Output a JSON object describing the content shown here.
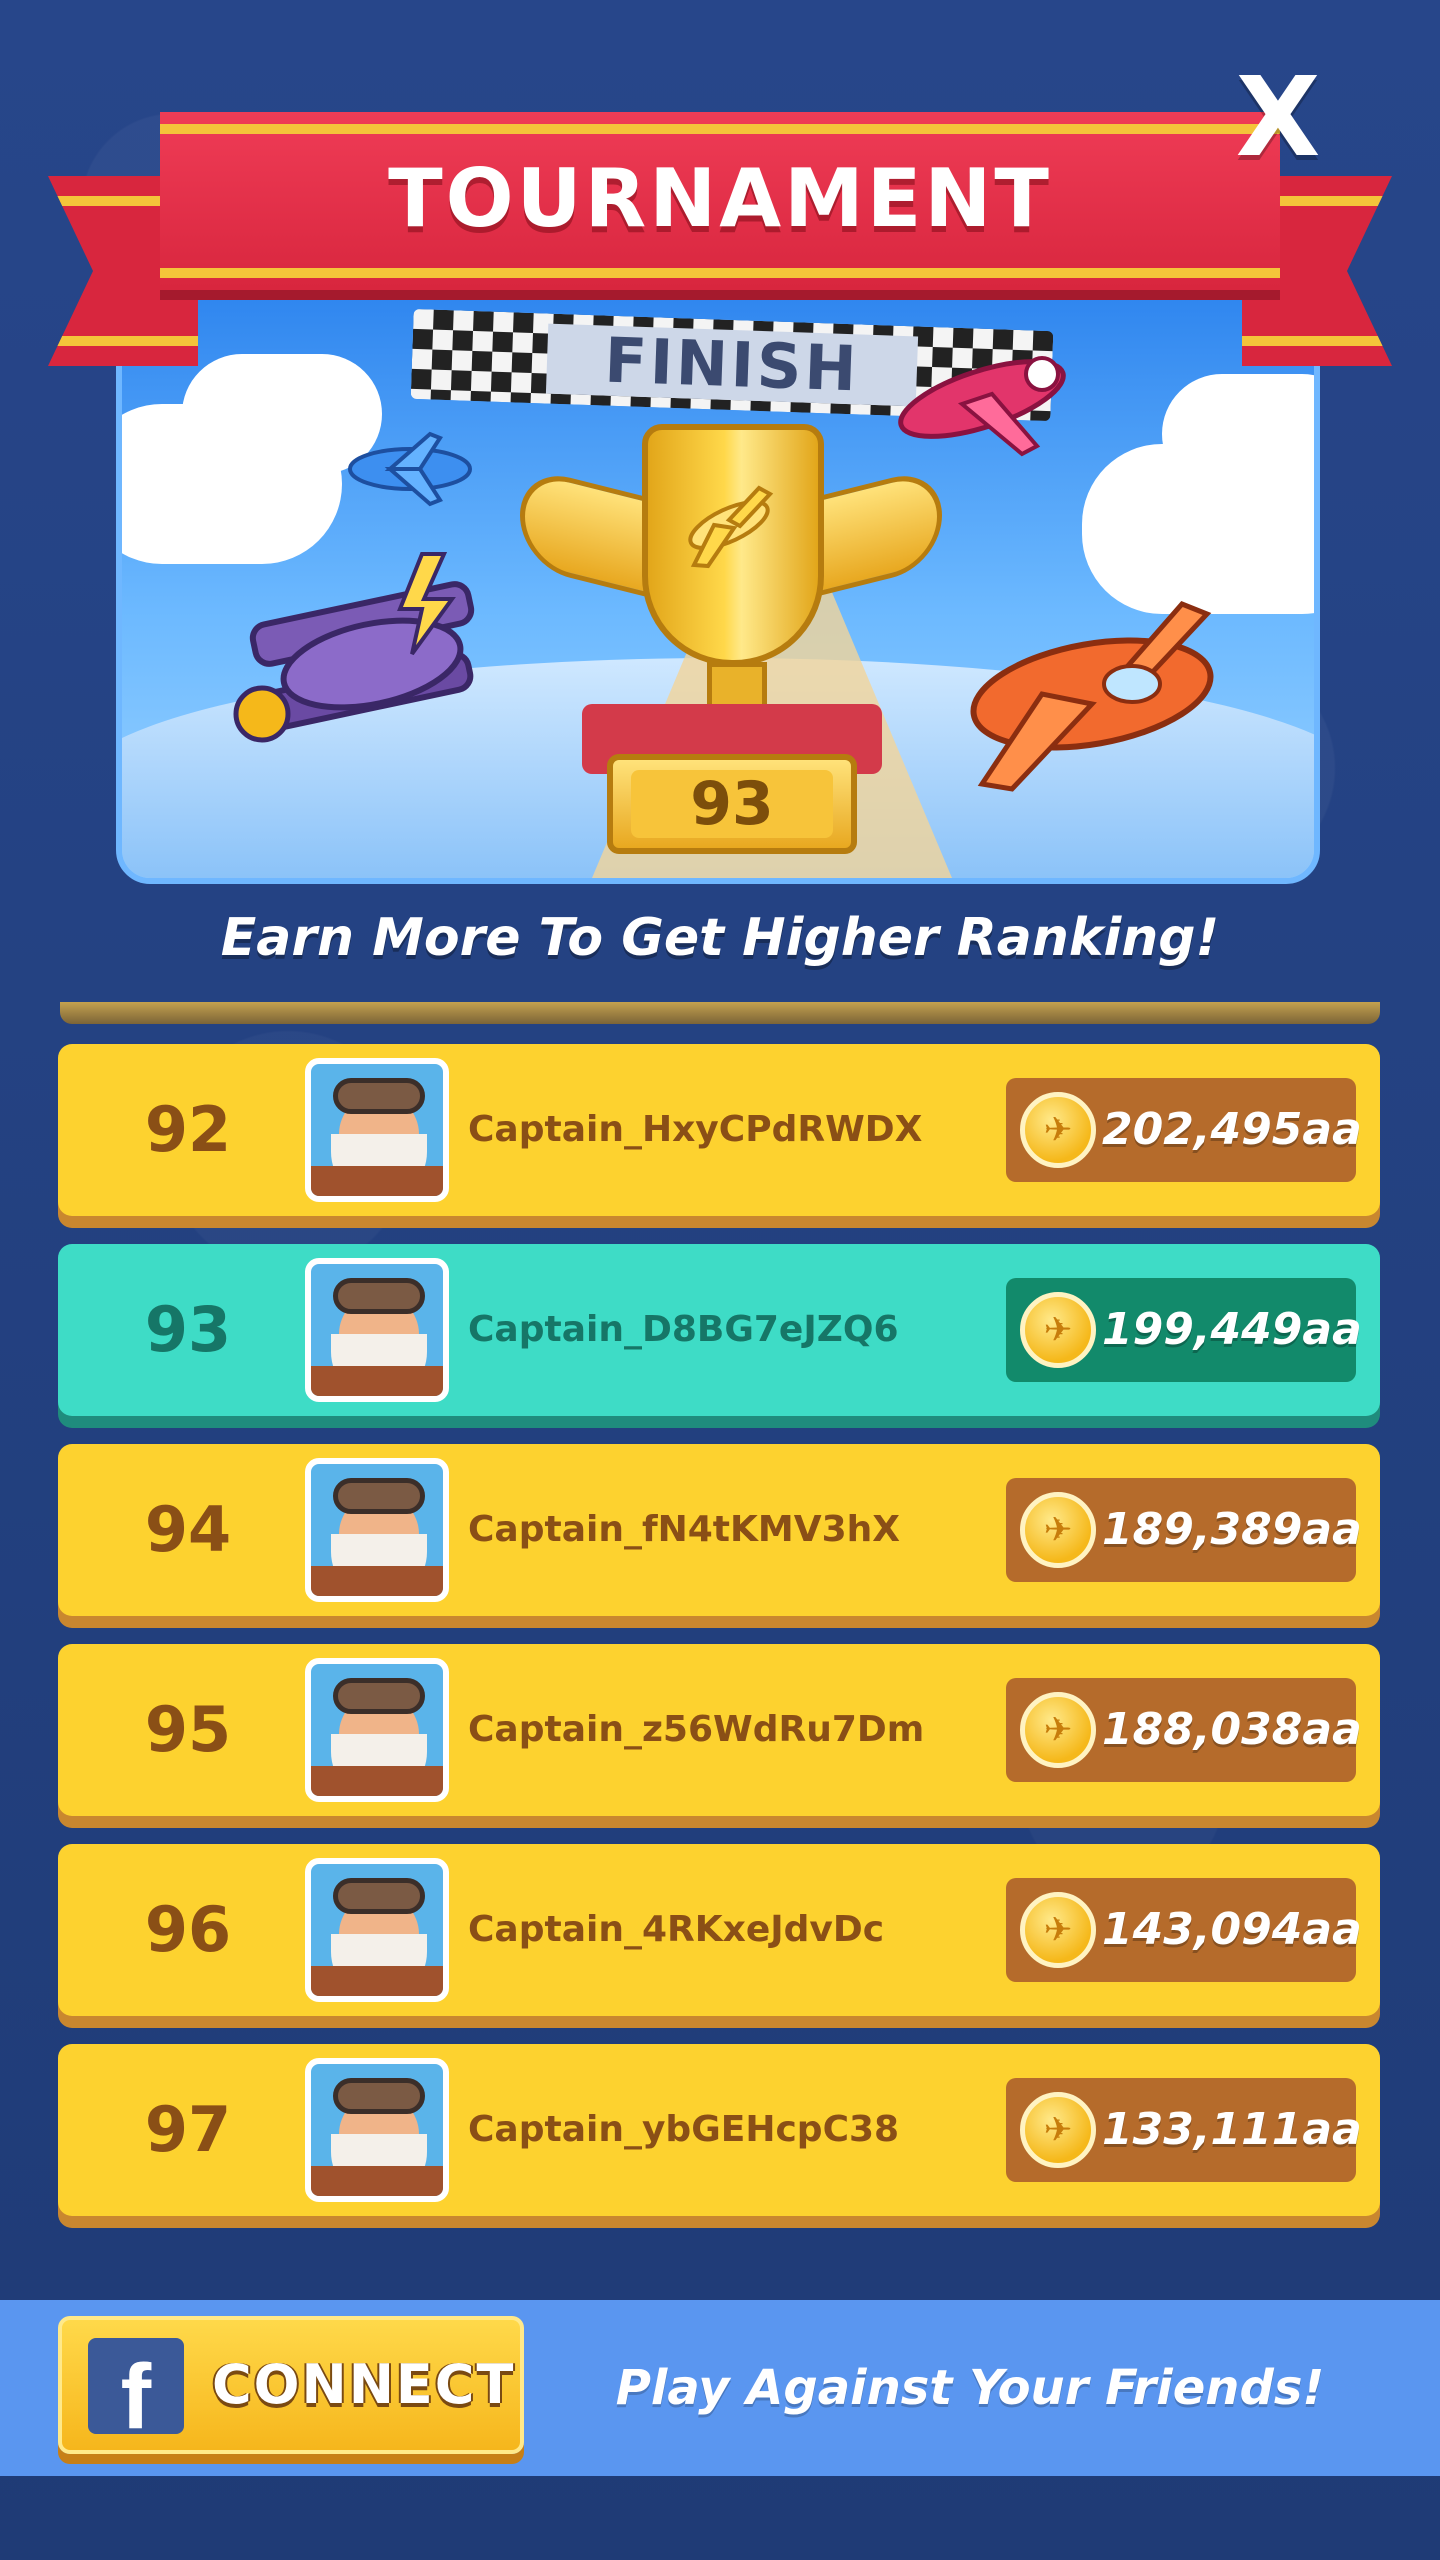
{
  "header": {
    "title": "TOURNAMENT",
    "close_label": "X"
  },
  "hero": {
    "finish_label": "FINISH",
    "trophy_rank": "93",
    "icons": [
      "trophy-icon",
      "plane-icon",
      "finish-flag-icon"
    ]
  },
  "subtitle": "Earn More To Get Higher Ranking!",
  "leaderboard": [
    {
      "rank": "92",
      "name": "Captain_HxyCPdRWDX",
      "score": "202,495aa",
      "highlight": false
    },
    {
      "rank": "93",
      "name": "Captain_D8BG7eJZQ6",
      "score": "199,449aa",
      "highlight": true
    },
    {
      "rank": "94",
      "name": "Captain_fN4tKMV3hX",
      "score": "189,389aa",
      "highlight": false
    },
    {
      "rank": "95",
      "name": "Captain_z56WdRu7Dm",
      "score": "188,038aa",
      "highlight": false
    },
    {
      "rank": "96",
      "name": "Captain_4RKxeJdvDc",
      "score": "143,094aa",
      "highlight": false
    },
    {
      "rank": "97",
      "name": "Captain_ybGEHcpC38",
      "score": "133,111aa",
      "highlight": false
    }
  ],
  "footer": {
    "connect_label": "CONNECT",
    "fb_glyph": "f",
    "promo_text": "Play Against Your Friends!"
  },
  "colors": {
    "background": "#223f7a",
    "row_gold": "#fdd22f",
    "row_highlight": "#3edcc6",
    "banner_red": "#d8263e",
    "footer_blue": "#5a96f0",
    "facebook": "#3b5998"
  }
}
